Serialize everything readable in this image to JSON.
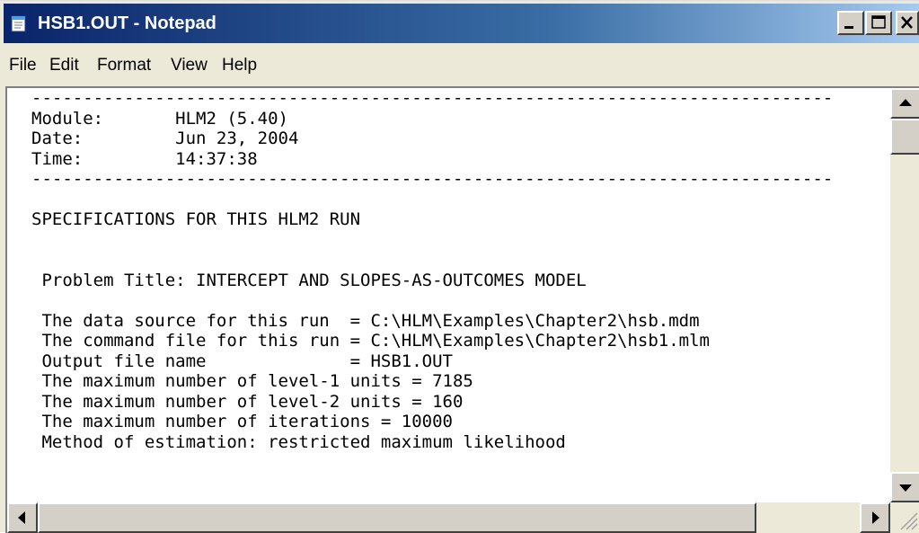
{
  "window": {
    "title": "HSB1.OUT - Notepad",
    "colors": {
      "titlebar_start": "#0a246a",
      "titlebar_end": "#a6caf0",
      "chrome": "#ece9d8"
    }
  },
  "icons": {
    "app": "notepad-icon",
    "minimize": "minimize-icon",
    "maximize": "maximize-icon",
    "close": "close-icon",
    "scroll_up": "arrow-up-icon",
    "scroll_down": "arrow-down-icon",
    "scroll_left": "arrow-left-icon",
    "scroll_right": "arrow-right-icon",
    "size_grip": "size-grip-icon"
  },
  "menu": {
    "file": "File",
    "edit": "Edit",
    "format": "Format",
    "view": "View",
    "help": "Help"
  },
  "document": {
    "text": "------------------------------------------------------------------------------\nModule:       HLM2 (5.40)\nDate:         Jun 23, 2004\nTime:         14:37:38\n------------------------------------------------------------------------------\n\nSPECIFICATIONS FOR THIS HLM2 RUN\n\n\n Problem Title: INTERCEPT AND SLOPES-AS-OUTCOMES MODEL\n\n The data source for this run  = C:\\HLM\\Examples\\Chapter2\\hsb.mdm\n The command file for this run = C:\\HLM\\Examples\\Chapter2\\hsb1.mlm\n Output file name              = HSB1.OUT\n The maximum number of level-1 units = 7185\n The maximum number of level-2 units = 160\n The maximum number of iterations = 10000\n Method of estimation: restricted maximum likelihood"
  }
}
